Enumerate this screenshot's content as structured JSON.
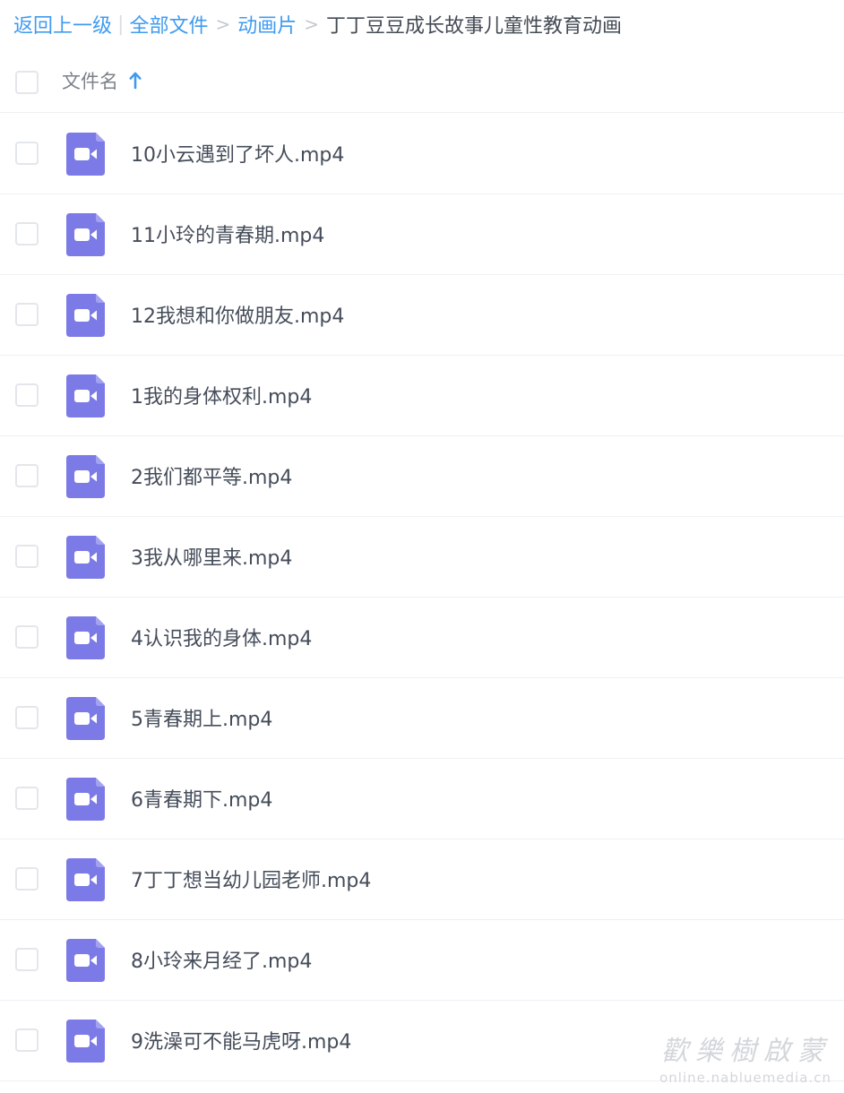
{
  "breadcrumb": {
    "back": "返回上一级",
    "separator_pipe": "|",
    "items": [
      "全部文件",
      "动画片"
    ],
    "separator": ">",
    "current": "丁丁豆豆成长故事儿童性教育动画"
  },
  "header": {
    "column_label": "文件名",
    "sort_icon": "arrow-up-icon"
  },
  "files": [
    {
      "name": "10小云遇到了坏人.mp4",
      "icon": "video-file-icon"
    },
    {
      "name": "11小玲的青春期.mp4",
      "icon": "video-file-icon"
    },
    {
      "name": "12我想和你做朋友.mp4",
      "icon": "video-file-icon"
    },
    {
      "name": "1我的身体权利.mp4",
      "icon": "video-file-icon"
    },
    {
      "name": "2我们都平等.mp4",
      "icon": "video-file-icon"
    },
    {
      "name": "3我从哪里来.mp4",
      "icon": "video-file-icon"
    },
    {
      "name": "4认识我的身体.mp4",
      "icon": "video-file-icon"
    },
    {
      "name": "5青春期上.mp4",
      "icon": "video-file-icon"
    },
    {
      "name": "6青春期下.mp4",
      "icon": "video-file-icon"
    },
    {
      "name": "7丁丁想当幼儿园老师.mp4",
      "icon": "video-file-icon"
    },
    {
      "name": "8小玲来月经了.mp4",
      "icon": "video-file-icon"
    },
    {
      "name": "9洗澡可不能马虎呀.mp4",
      "icon": "video-file-icon"
    }
  ],
  "watermark": {
    "title": "歡樂樹啟蒙",
    "url": "online.nabluemedia.cn"
  },
  "colors": {
    "link": "#3f9bf0",
    "video_icon": "#7b7ae6",
    "text": "#454d5a",
    "divider": "#eef0f3"
  }
}
